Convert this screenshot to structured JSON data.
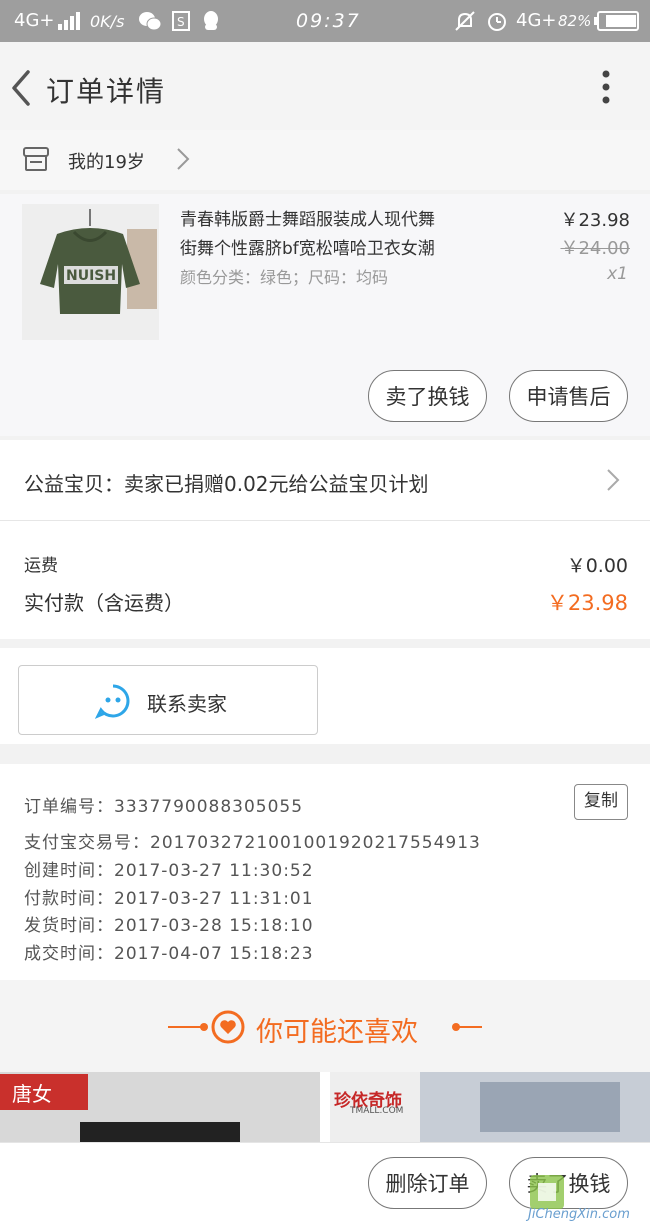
{
  "status_bar": {
    "network_left": "4G+",
    "speed": "0K/s",
    "time": "09:37",
    "network_right": "4G+",
    "battery": "82%"
  },
  "header": {
    "title": "订单详情"
  },
  "shop": {
    "name": "我的19岁"
  },
  "product": {
    "title_line1": "青春韩版爵士舞蹈服装成人现代舞",
    "title_line2": "街舞个性露脐bf宽松嘻哈卫衣女潮",
    "sku": "颜色分类：绿色；尺码：均码",
    "price": "￥23.98",
    "original_price": "￥24.00",
    "quantity": "x1",
    "image_text": "NUISH",
    "btn_exchange": "卖了换钱",
    "btn_after_sale": "申请售后"
  },
  "charity": {
    "text": "公益宝贝：卖家已捐赠0.02元给公益宝贝计划"
  },
  "fees": {
    "shipping_label": "运费",
    "shipping_value": "￥0.00",
    "paid_label": "实付款（含运费）",
    "paid_value": "￥23.98"
  },
  "contact": {
    "label": "联系卖家"
  },
  "order_info": {
    "order_no": "订单编号：3337790088305055",
    "copy_label": "复制",
    "alipay_no": "支付宝交易号：2017032721001001920217554913",
    "created": "创建时间：2017-03-27  11:30:52",
    "paid": "付款时间：2017-03-27  11:31:01",
    "shipped": "发货时间：2017-03-28  15:18:10",
    "completed": "成交时间：2017-04-07  15:18:23"
  },
  "recommend": {
    "title": "你可能还喜欢",
    "card1_brand": "唐女",
    "card2_brand": "珍依奇饰",
    "card2_sub": "TMALL.COM"
  },
  "bottom_bar": {
    "delete_label": "删除订单",
    "exchange_label": "卖了换钱"
  },
  "watermark": {
    "text": "JiChengXin.com"
  },
  "colors": {
    "accent": "#f36c21",
    "status_bg": "#9e9e9e"
  }
}
